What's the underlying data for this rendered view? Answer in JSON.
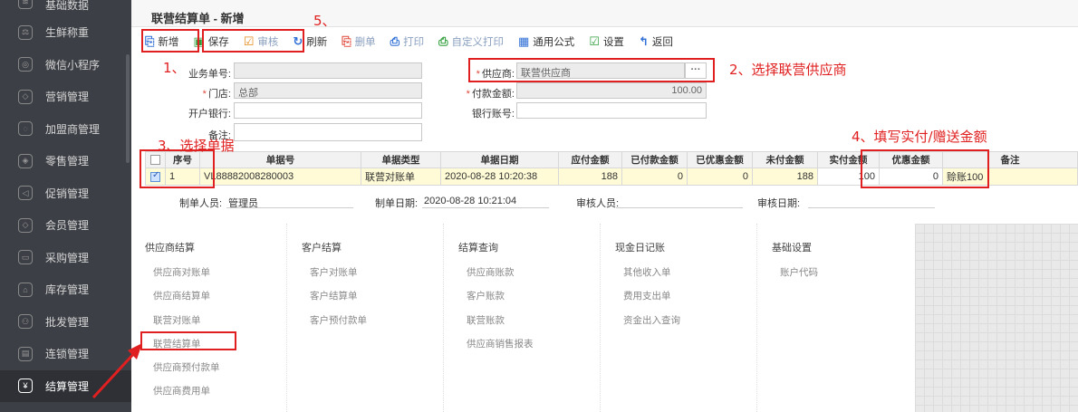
{
  "sidebar": {
    "items": [
      {
        "label": "基础数据",
        "icon": "gear-icon",
        "glyph": "≋"
      },
      {
        "label": "生鲜称重",
        "icon": "scale-icon",
        "glyph": "⚖"
      },
      {
        "label": "微信小程序",
        "icon": "wechat-icon",
        "glyph": "◎"
      },
      {
        "label": "营销管理",
        "icon": "diamond-icon",
        "glyph": "◇"
      },
      {
        "label": "加盟商管理",
        "icon": "handshake-icon",
        "glyph": "◌"
      },
      {
        "label": "零售管理",
        "icon": "tag-icon",
        "glyph": "◈"
      },
      {
        "label": "促销管理",
        "icon": "promo-icon",
        "glyph": "◁"
      },
      {
        "label": "会员管理",
        "icon": "member-icon",
        "glyph": "◇"
      },
      {
        "label": "采购管理",
        "icon": "cart-icon",
        "glyph": "▭"
      },
      {
        "label": "库存管理",
        "icon": "warehouse-icon",
        "glyph": "⌂"
      },
      {
        "label": "批发管理",
        "icon": "people-icon",
        "glyph": "⚇"
      },
      {
        "label": "连锁管理",
        "icon": "chain-icon",
        "glyph": "▤"
      },
      {
        "label": "结算管理",
        "icon": "settlement-icon",
        "glyph": "¥"
      }
    ]
  },
  "page": {
    "title": "联营结算单 - 新增"
  },
  "toolbar": {
    "new": "新增",
    "save": "保存",
    "audit": "审核",
    "refresh": "刷新",
    "delete": "删单",
    "print": "打印",
    "custom_print": "自定义打印",
    "formula": "通用公式",
    "settings": "设置",
    "back": "返回"
  },
  "form": {
    "biz_no_label": "业务单号:",
    "biz_no_value": "",
    "supplier_label": "供应商:",
    "supplier_value": "联营供应商",
    "store_label": "门店:",
    "store_value": "总部",
    "pay_amount_label": "付款金额:",
    "pay_amount_value": "100.00",
    "bank_label": "开户银行:",
    "account_label": "银行账号:",
    "remark_label": "备注:",
    "more_button": "···"
  },
  "annotations": {
    "a1": "1、",
    "a2": "2、选择联营供应商",
    "a3": "3、选择单据",
    "a4": "4、填写实付/赠送金额",
    "a5": "5、"
  },
  "table": {
    "headers": [
      "序号",
      "单据号",
      "单据类型",
      "单据日期",
      "应付金额",
      "已付款金额",
      "已优惠金额",
      "未付金额",
      "实付金额",
      "优惠金额",
      "备注"
    ],
    "rows": [
      {
        "seq": "1",
        "doc_no": "VL88882008280003",
        "doc_type": "联营对账单",
        "doc_date": "2020-08-28 10:20:38",
        "payable": "188",
        "paid": "0",
        "discounted": "0",
        "unpaid": "188",
        "actual": "100",
        "discount": "0",
        "remark": "赊账100"
      }
    ]
  },
  "footer": {
    "maker_label": "制单人员:",
    "maker_value": "管理员",
    "make_date_label": "制单日期:",
    "make_date_value": "2020-08-28 10:21:04",
    "auditor_label": "审核人员:",
    "audit_date_label": "审核日期:"
  },
  "menu": {
    "columns": [
      {
        "head": "供应商结算",
        "links": [
          "供应商对账单",
          "供应商结算单",
          "联营对账单",
          "联营结算单",
          "供应商预付款单",
          "供应商费用单"
        ]
      },
      {
        "head": "客户结算",
        "links": [
          "客户对账单",
          "客户结算单",
          "客户预付款单"
        ]
      },
      {
        "head": "结算查询",
        "links": [
          "供应商账款",
          "客户账款",
          "联营账款",
          "供应商销售报表"
        ]
      },
      {
        "head": "现金日记账",
        "links": [
          "其他收入单",
          "费用支出单",
          "资金出入查询"
        ]
      },
      {
        "head": "基础设置",
        "links": [
          "账户代码"
        ]
      }
    ]
  },
  "colors": {
    "accent": "#e02020",
    "sidebar_bg": "#3c3f45",
    "row_highlight": "#fffbd6"
  }
}
